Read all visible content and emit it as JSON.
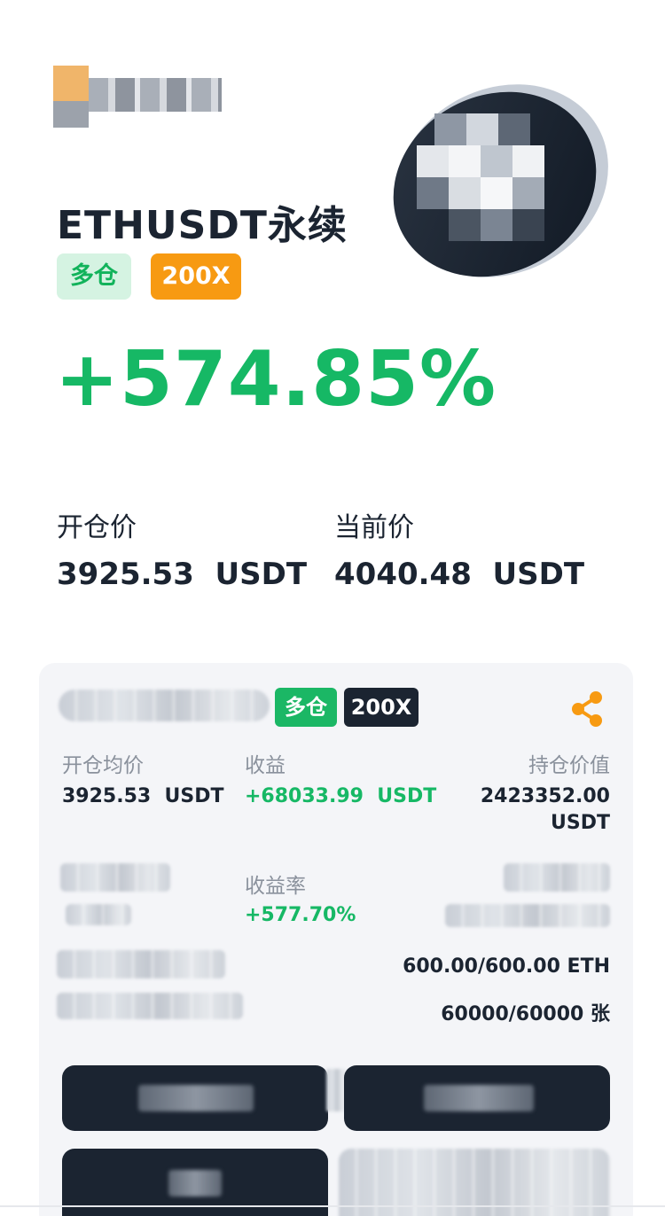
{
  "header": {
    "pair_title": "ETHUSDT永续",
    "side_tag": "多仓",
    "leverage_tag": "200X",
    "pnl_percent": "+574.85%"
  },
  "prices": {
    "open_label": "开仓价",
    "open_value": "3925.53  USDT",
    "current_label": "当前价",
    "current_value": "4040.48  USDT"
  },
  "card": {
    "side_tag": "多仓",
    "leverage_tag": "200X",
    "avg_open_label": "开仓均价",
    "avg_open_value": "3925.53  USDT",
    "profit_label": "收益",
    "profit_value": "+68033.99  USDT",
    "position_value_label": "持仓价值",
    "position_value_line1": "2423352.00",
    "position_value_line2": "USDT",
    "profit_rate_label": "收益率",
    "profit_rate_value": "+577.70%",
    "size_eth": "600.00/600.00 ETH",
    "size_contracts": "60000/60000 张"
  },
  "colors": {
    "green": "#16b865",
    "orange": "#f79a12",
    "dark": "#1b2431"
  }
}
